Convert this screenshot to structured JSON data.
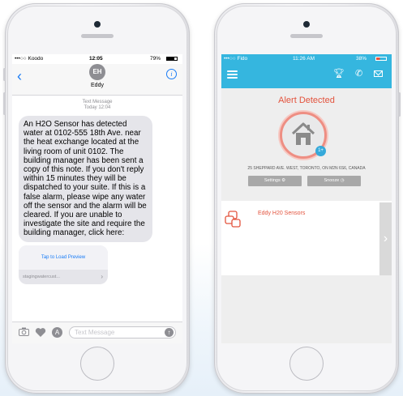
{
  "left_phone": {
    "status": {
      "carrier": "•••○○ Koodo",
      "time": "12:05",
      "battery": "79%"
    },
    "contact": {
      "initials": "EH",
      "name": "Eddy"
    },
    "meta": {
      "type": "Text Message",
      "time": "Today 12:04"
    },
    "message": "An H2O Sensor has detected water at 0102-555 18th Ave. near the heat exchange located at the living room of unit 0102. The building manager has been sent a copy of this note. If you don't reply within 15 minutes they will be dispatched to your suite. If this is a false alarm, please wipe any water off the sensor and the alarm will be cleared. If you are unable to investigate the site and require the building manager, click here:",
    "preview": {
      "load": "Tap to Load Preview",
      "url": "stagingwatercust..."
    },
    "input": {
      "placeholder": "Text Message"
    }
  },
  "right_phone": {
    "status": {
      "carrier": "•••○○ Fido",
      "time": "11:26 AM",
      "battery": "38%"
    },
    "alert_title": "Alert Detected",
    "badge": "1+",
    "address": "25 SHEPPARD AVE. WEST, TORONTO, ON M2N 6S6, CANADA",
    "buttons": {
      "settings": "Settings",
      "snooze": "Snooze"
    },
    "sensor_name": "Eddy H20 Sensors",
    "colors": {
      "brand": "#35b6df",
      "alert": "#e3533d"
    }
  }
}
